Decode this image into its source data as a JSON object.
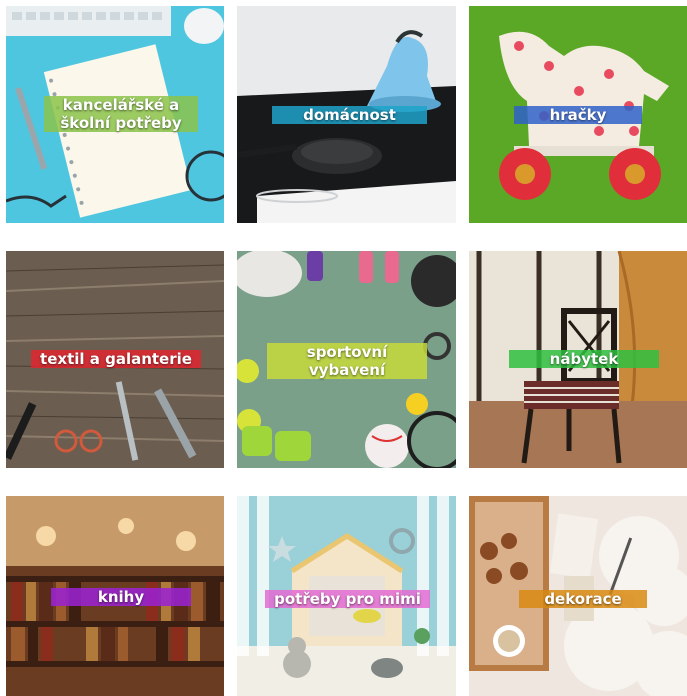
{
  "categories": [
    {
      "label": "kancelářské a\nškolní potřeby",
      "accent": "#8bc34a"
    },
    {
      "label": "domácnost",
      "accent": "#1fa3c9"
    },
    {
      "label": "hračky",
      "accent": "#2f62c9"
    },
    {
      "label": "textil a galanterie",
      "accent": "#e0262f"
    },
    {
      "label": "sportovní\nvybavení",
      "accent": "#c7d93a"
    },
    {
      "label": "nábytek",
      "accent": "#2fbf3f"
    },
    {
      "label": "knihy",
      "accent": "#9b22d6"
    },
    {
      "label": "potřeby pro mimi",
      "accent": "#e36bd3"
    },
    {
      "label": "dekorace",
      "accent": "#d98a12"
    }
  ]
}
